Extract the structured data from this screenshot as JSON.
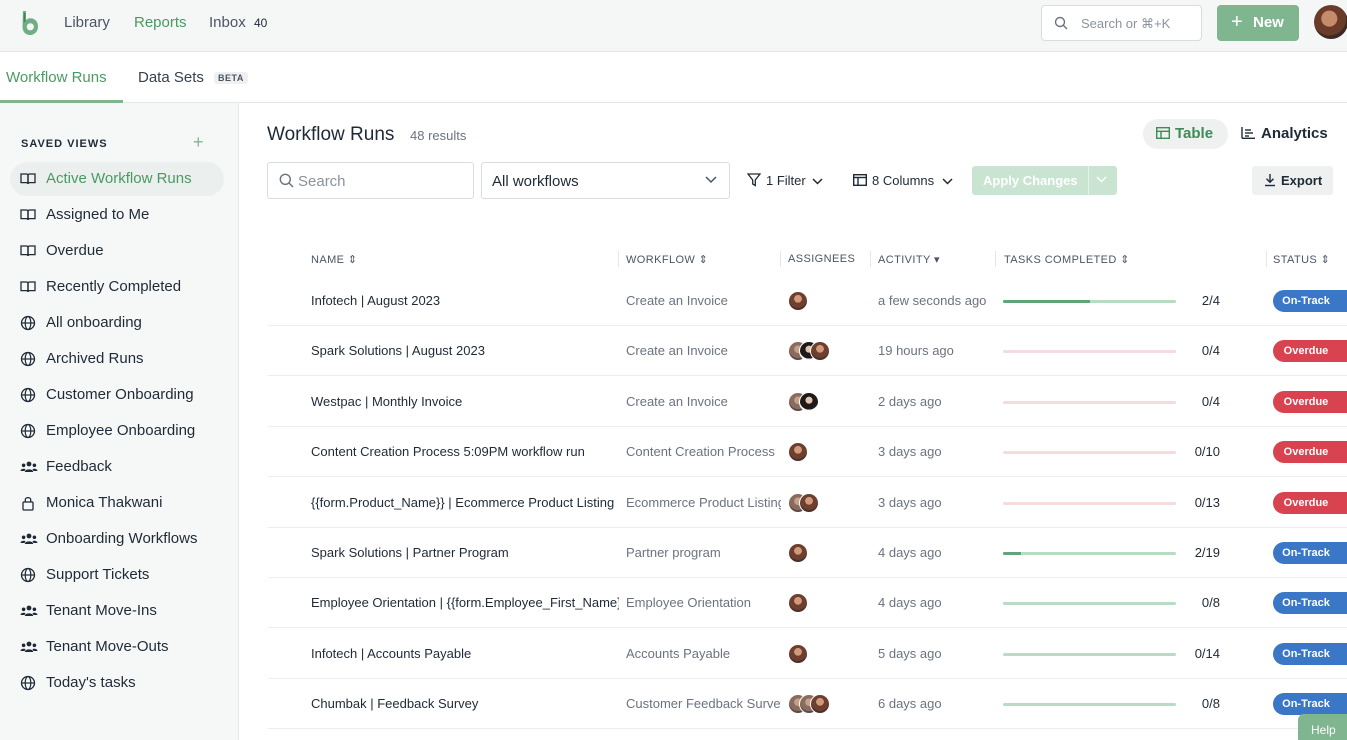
{
  "topnav": {
    "items": [
      {
        "label": "Library"
      },
      {
        "label": "Reports"
      },
      {
        "label": "Inbox",
        "count": "40"
      }
    ],
    "search_placeholder": "Search or ⌘+K",
    "new_label": "New",
    "accent_color": "#7fb690"
  },
  "subtabs": {
    "items": [
      {
        "label": "Workflow Runs"
      },
      {
        "label": "Data Sets",
        "badge": "BETA"
      }
    ]
  },
  "sidebar": {
    "heading": "SAVED VIEWS",
    "items": [
      {
        "label": "Active Workflow Runs",
        "icon": "book-icon"
      },
      {
        "label": "Assigned to Me",
        "icon": "book-icon"
      },
      {
        "label": "Overdue",
        "icon": "book-icon"
      },
      {
        "label": "Recently Completed",
        "icon": "book-icon"
      },
      {
        "label": "All onboarding",
        "icon": "globe-icon"
      },
      {
        "label": "Archived Runs",
        "icon": "globe-icon"
      },
      {
        "label": "Customer Onboarding",
        "icon": "globe-icon"
      },
      {
        "label": "Employee Onboarding",
        "icon": "globe-icon"
      },
      {
        "label": "Feedback",
        "icon": "users-icon"
      },
      {
        "label": "Monica Thakwani",
        "icon": "lock-icon"
      },
      {
        "label": "Onboarding Workflows",
        "icon": "users-icon"
      },
      {
        "label": "Support Tickets",
        "icon": "globe-icon"
      },
      {
        "label": "Tenant Move-Ins",
        "icon": "users-icon"
      },
      {
        "label": "Tenant Move-Outs",
        "icon": "users-icon"
      },
      {
        "label": "Today's tasks",
        "icon": "globe-icon"
      }
    ]
  },
  "main": {
    "title": "Workflow Runs",
    "results": "48 results",
    "view_table": "Table",
    "view_analytics": "Analytics",
    "search_placeholder": "Search",
    "workflow_select": "All workflows",
    "filter_label": "1 Filter",
    "columns_label": "8 Columns",
    "apply_label": "Apply Changes",
    "export_label": "Export",
    "columns": [
      "NAME",
      "WORKFLOW",
      "ASSIGNEES",
      "ACTIVITY",
      "TASKS COMPLETED",
      "STATUS"
    ],
    "rows": [
      {
        "name": "Infotech | August 2023",
        "workflow": "Create an Invoice",
        "assignees": [
          "a1"
        ],
        "activity": "a few seconds ago",
        "completed": 2,
        "total": 4,
        "ratio": "2/4",
        "status": "On-Track"
      },
      {
        "name": "Spark Solutions | August 2023",
        "workflow": "Create an Invoice",
        "assignees": [
          "a2",
          "a3",
          "a1"
        ],
        "activity": "19 hours ago",
        "completed": 0,
        "total": 4,
        "ratio": "0/4",
        "status": "Overdue"
      },
      {
        "name": "Westpac | Monthly Invoice",
        "workflow": "Create an Invoice",
        "assignees": [
          "a2",
          "a3"
        ],
        "activity": "2 days ago",
        "completed": 0,
        "total": 4,
        "ratio": "0/4",
        "status": "Overdue"
      },
      {
        "name": "Content Creation Process 5:09PM workflow run",
        "workflow": "Content Creation Process",
        "assignees": [
          "a1"
        ],
        "activity": "3 days ago",
        "completed": 0,
        "total": 10,
        "ratio": "0/10",
        "status": "Overdue"
      },
      {
        "name": "{{form.Product_Name}} | Ecommerce Product Listing",
        "workflow": "Ecommerce Product Listing",
        "assignees": [
          "a2",
          "a1"
        ],
        "activity": "3 days ago",
        "completed": 0,
        "total": 13,
        "ratio": "0/13",
        "status": "Overdue"
      },
      {
        "name": "Spark Solutions | Partner Program",
        "workflow": "Partner program",
        "assignees": [
          "a1"
        ],
        "activity": "4 days ago",
        "completed": 2,
        "total": 19,
        "ratio": "2/19",
        "status": "On-Track"
      },
      {
        "name": "Employee Orientation | {{form.Employee_First_Name}}",
        "workflow": "Employee Orientation",
        "assignees": [
          "a1"
        ],
        "activity": "4 days ago",
        "completed": 0,
        "total": 8,
        "ratio": "0/8",
        "status": "On-Track"
      },
      {
        "name": "Infotech | Accounts Payable",
        "workflow": "Accounts Payable",
        "assignees": [
          "a1"
        ],
        "activity": "5 days ago",
        "completed": 0,
        "total": 14,
        "ratio": "0/14",
        "status": "On-Track"
      },
      {
        "name": "Chumbak | Feedback Survey",
        "workflow": "Customer Feedback Survey",
        "assignees": [
          "a2",
          "a2",
          "a1"
        ],
        "activity": "6 days ago",
        "completed": 0,
        "total": 8,
        "ratio": "0/8",
        "status": "On-Track"
      }
    ],
    "status_colors": {
      "On-Track": "#3a77c7",
      "Overdue": "#d8434f"
    }
  },
  "help_label": "Help"
}
